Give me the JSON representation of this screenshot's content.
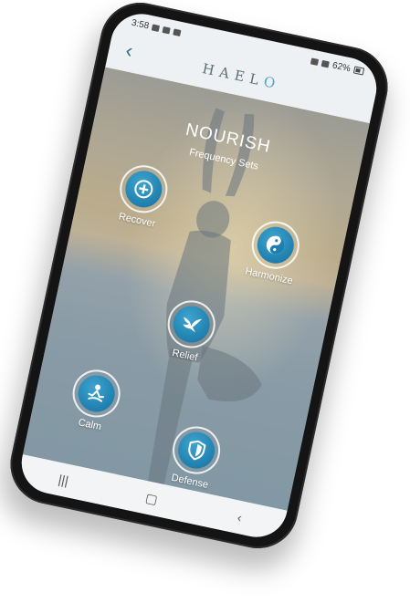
{
  "status_bar": {
    "time": "3:58",
    "battery_percent": "62%"
  },
  "header": {
    "brand_main": "HAEL",
    "brand_accent": "O"
  },
  "main": {
    "title": "NOURISH",
    "subtitle": "Frequency Sets",
    "sets": [
      {
        "label": "Recover",
        "icon": "plus-circle-icon"
      },
      {
        "label": "Harmonize",
        "icon": "yin-yang-icon"
      },
      {
        "label": "Relief",
        "icon": "dove-icon"
      },
      {
        "label": "Calm",
        "icon": "meditation-icon"
      },
      {
        "label": "Defense",
        "icon": "shield-icon"
      }
    ]
  },
  "colors": {
    "accent": "#1f7fae",
    "brand_accent": "#4da6c5"
  }
}
